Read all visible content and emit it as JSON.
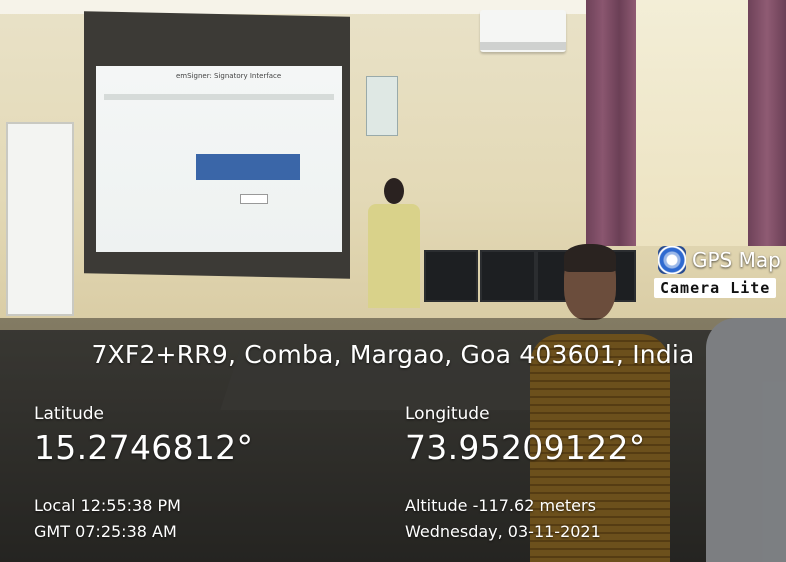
{
  "watermark": {
    "title": "GPS Map",
    "subtitle": "Camera Lite",
    "icon": "gps-map-camera-icon"
  },
  "location": {
    "address": "7XF2+RR9, Comba, Margao, Goa 403601, India",
    "latitude_label": "Latitude",
    "latitude_value": "15.2746812°",
    "longitude_label": "Longitude",
    "longitude_value": "73.95209122°",
    "local_time": "Local 12:55:38 PM",
    "gmt_time": "GMT 07:25:38 AM",
    "altitude": "Altitude -117.62 meters",
    "date": "Wednesday, 03-11-2021"
  },
  "projection": {
    "slide_title": "emSigner: Signatory Interface"
  }
}
